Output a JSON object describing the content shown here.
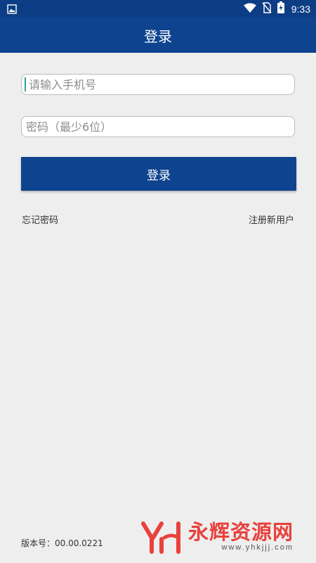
{
  "status_bar": {
    "time": "9:33",
    "icons": [
      "image-icon",
      "wifi-icon",
      "no-sim-icon",
      "battery-charging-icon"
    ]
  },
  "app_bar": {
    "title": "登录"
  },
  "form": {
    "phone_placeholder": "请输入手机号",
    "password_placeholder": "密码（最少6位）",
    "login_button": "登录"
  },
  "links": {
    "forgot_password": "忘记密码",
    "register": "注册新用户"
  },
  "footer": {
    "version": "版本号：00.00.0221"
  },
  "watermark": {
    "logo_text": "YH",
    "title": "永辉资源网",
    "url": "www.yhkjjj.com"
  },
  "colors": {
    "primary": "#0e438f",
    "status_bar": "#0d3e85",
    "background": "#eeeeee",
    "caret": "#27a39a",
    "watermark": "#e8413d"
  }
}
